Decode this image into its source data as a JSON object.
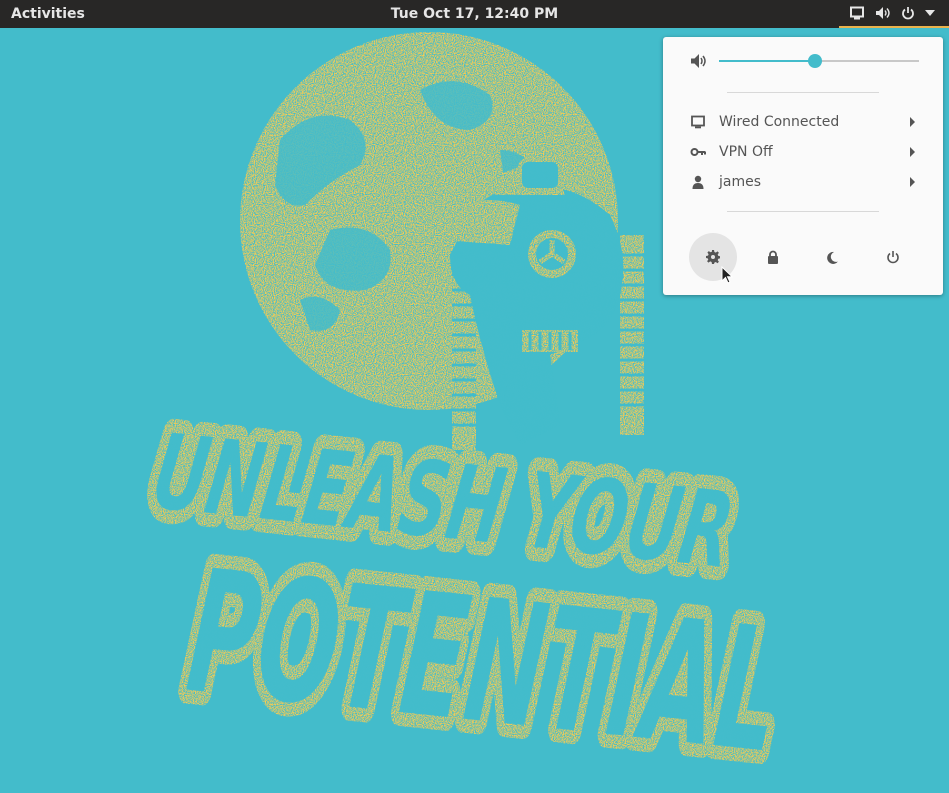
{
  "topbar": {
    "activities": "Activities",
    "clock": "Tue Oct 17, 12:40 PM",
    "tray_icons": [
      "display-icon",
      "speaker-icon",
      "power-icon",
      "chevron-down-icon"
    ]
  },
  "wallpaper": {
    "line1": "UNLEASH YOUR",
    "line2": "POTENTIAL"
  },
  "system_menu": {
    "volume": {
      "icon": "speaker-icon",
      "level_percent": 48
    },
    "items": [
      {
        "icon": "display-icon",
        "label": "Wired Connected"
      },
      {
        "icon": "key-icon",
        "label": "VPN Off"
      },
      {
        "icon": "user-icon",
        "label": "james"
      }
    ],
    "actions": [
      "settings-icon",
      "lock-icon",
      "moon-icon",
      "power-icon"
    ]
  },
  "colors": {
    "background": "#43bccb",
    "art": "#fccb4f",
    "topbar": "#282726",
    "accent": "#43bccb"
  }
}
